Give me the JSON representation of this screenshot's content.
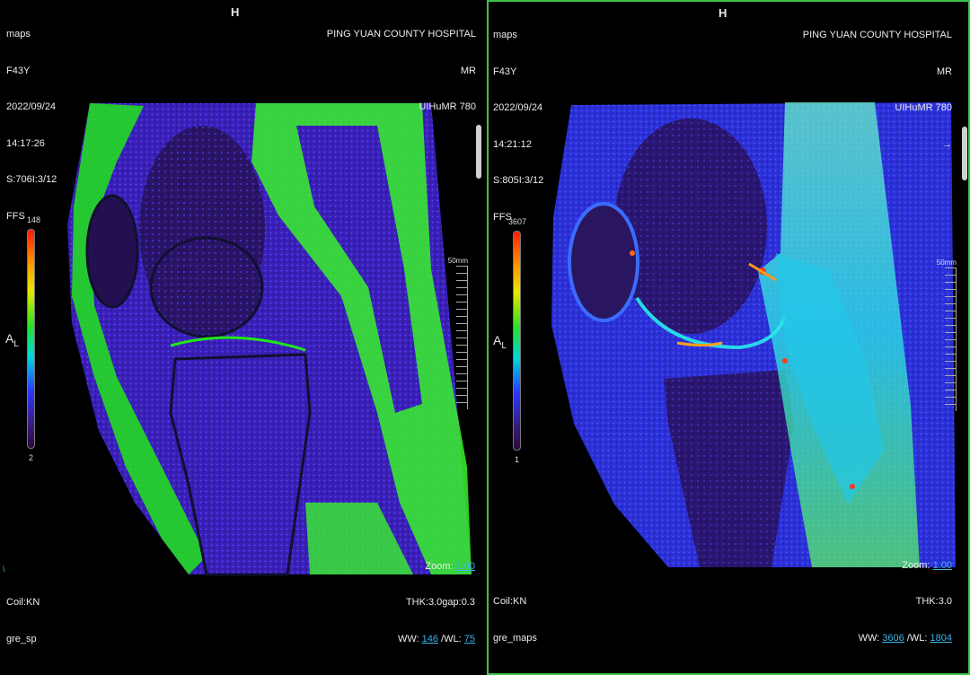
{
  "left": {
    "top_left": [
      "maps",
      "F43Y",
      "2022/09/24",
      "14:17:26",
      "S:706I:3/12",
      "FFS"
    ],
    "top_center": "H",
    "top_right": [
      "PING YUAN COUNTY HOSPITAL",
      "MR",
      "UIHuMR 780"
    ],
    "bottom_left": [
      "Coil:KN",
      "gre_sp"
    ],
    "zoom_label": "Zoom: ",
    "zoom": "1.00",
    "thk": "THK:3.0gap:0.3",
    "ww_label": "WW: ",
    "ww": "146",
    "wl_label": " /WL: ",
    "wl": "75",
    "colorbar_max": "148",
    "colorbar_min": "2",
    "orientation": "A",
    "orientation_sub": "L",
    "ruler_label": "50mm",
    "corner_mark": "\\"
  },
  "right": {
    "top_left": [
      "maps",
      "F43Y",
      "2022/09/24",
      "14:21:12",
      "S:805I:3/12",
      "FFS"
    ],
    "top_center": "H",
    "top_right": [
      "PING YUAN COUNTY HOSPITAL",
      "MR",
      "UIHuMR 780",
      "→"
    ],
    "bottom_left": [
      "Coil:KN",
      "gre_maps"
    ],
    "zoom_label": "Zoom: ",
    "zoom": "1.00",
    "thk": "THK:3.0",
    "ww_label": "WW: ",
    "ww": "3606",
    "wl_label": " /WL: ",
    "wl": "1804",
    "colorbar_max": "3607",
    "colorbar_min": "1",
    "orientation": "A",
    "orientation_sub": "L",
    "ruler_label": "50mm"
  },
  "colors": {
    "active_border": "#3ec24a",
    "link_value": "#3db3e6",
    "background": "#000000"
  }
}
